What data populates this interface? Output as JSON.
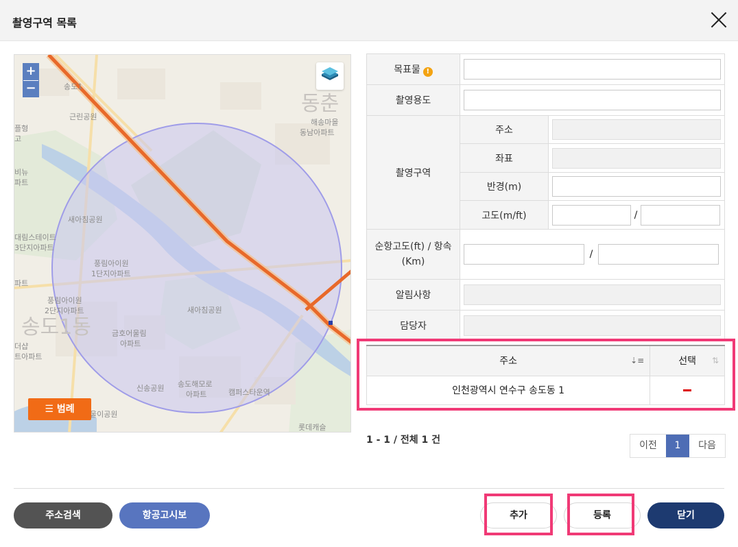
{
  "dialog": {
    "title": "촬영구역 목록"
  },
  "map": {
    "legend_label": "범례",
    "zoom_in": "+",
    "zoom_out": "−",
    "labels": [
      "송도1",
      "근린공원",
      "해송마을",
      "동남아파트",
      "동춘",
      "새아침공원",
      "풍림아이원",
      "1단지아파트",
      "풍림아이원",
      "2단지아파트",
      "새아침공원",
      "송도1동",
      "금호어울림",
      "아파트",
      "신송공원",
      "송도해모로",
      "아파트",
      "캠퍼스타운역",
      "롯데캐슬",
      "울이공원",
      "대림스테이트",
      "3단지아파트",
      "비뉴",
      "파트",
      "플형",
      "고",
      "파트",
      "더샵",
      "트아파트"
    ],
    "colors": {
      "route": "#e8692a",
      "circle_fill": "#c9c7ee",
      "circle_stroke": "#9f9ce8"
    }
  },
  "form": {
    "target_label": "목표물",
    "target_value": "",
    "purpose_label": "촬영용도",
    "purpose_value": "",
    "zone_label": "촬영구역",
    "address_label": "주소",
    "address_value": "",
    "coord_label": "좌표",
    "coord_value": "",
    "radius_label": "반경(m)",
    "radius_value": "",
    "altitude_label": "고도(m/ft)",
    "altitude_sep": "/",
    "cruise_label": "순항고도(ft) / 항속(Km)",
    "cruise_sep": "/",
    "notice_label": "알림사항",
    "manager_label": "담당자"
  },
  "grid": {
    "columns": [
      "주소",
      "선택"
    ],
    "rows": [
      {
        "address": "인천광역시 연수구 송도동 1"
      }
    ]
  },
  "pagination": {
    "summary": "1 - 1 / 전체 1 건",
    "prev": "이전",
    "current": "1",
    "next": "다음"
  },
  "actions": {
    "address_search": "주소검색",
    "aero_notice": "항공고시보",
    "add": "추가",
    "register": "등록",
    "close": "닫기"
  }
}
